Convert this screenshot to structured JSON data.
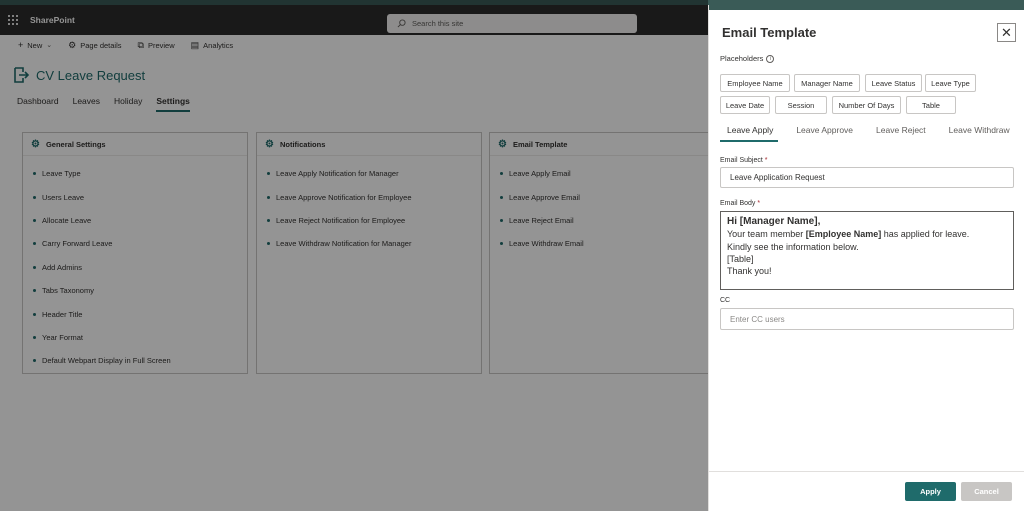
{
  "suitebar": {
    "app_name": "SharePoint",
    "search_placeholder": "Search this site"
  },
  "commandbar": {
    "new_label": "New",
    "page_details_label": "Page details",
    "preview_label": "Preview",
    "analytics_label": "Analytics"
  },
  "page": {
    "title": "CV Leave Request"
  },
  "tabs": [
    "Dashboard",
    "Leaves",
    "Holiday",
    "Settings"
  ],
  "active_tab": "Settings",
  "cards": [
    {
      "title": "General Settings",
      "items": [
        "Leave Type",
        "Users Leave",
        "Allocate Leave",
        "Carry Forward Leave",
        "Add Admins",
        "Tabs Taxonomy",
        "Header Title",
        "Year Format",
        "Default Webpart Display in Full Screen"
      ]
    },
    {
      "title": "Notifications",
      "items": [
        "Leave Apply Notification for Manager",
        "Leave Approve Notification for Employee",
        "Leave Reject Notification for Employee",
        "Leave Withdraw Notification for Manager"
      ]
    },
    {
      "title": "Email Template",
      "items": [
        "Leave Apply Email",
        "Leave Approve Email",
        "Leave Reject Email",
        "Leave Withdraw Email"
      ]
    }
  ],
  "panel": {
    "title": "Email Template",
    "placeholders_label": "Placeholders",
    "placeholders": [
      "Employee Name",
      "Manager Name",
      "Leave Status",
      "Leave Type",
      "Leave Date",
      "Session",
      "Number Of Days",
      "Table"
    ],
    "tabs": [
      "Leave Apply",
      "Leave Approve",
      "Leave Reject",
      "Leave Withdraw"
    ],
    "active_tab": "Leave Apply",
    "subject_label": "Email Subject",
    "subject_value": "Leave Application Request",
    "body_label": "Email Body",
    "body": {
      "greeting": "Hi [Manager Name],",
      "line1_prefix": "Your team member ",
      "line1_bold": "[Employee Name]",
      "line1_suffix": " has applied for leave.",
      "line2": "Kindly see the information below.",
      "line3": "[Table]",
      "line4": "Thank you!"
    },
    "cc_label": "CC",
    "cc_placeholder": "Enter CC users",
    "apply_label": "Apply",
    "cancel_label": "Cancel"
  },
  "colors": {
    "accent": "#1f6b6b",
    "suitebar": "#2b2b2b",
    "header_strip": "#3a5b57"
  }
}
